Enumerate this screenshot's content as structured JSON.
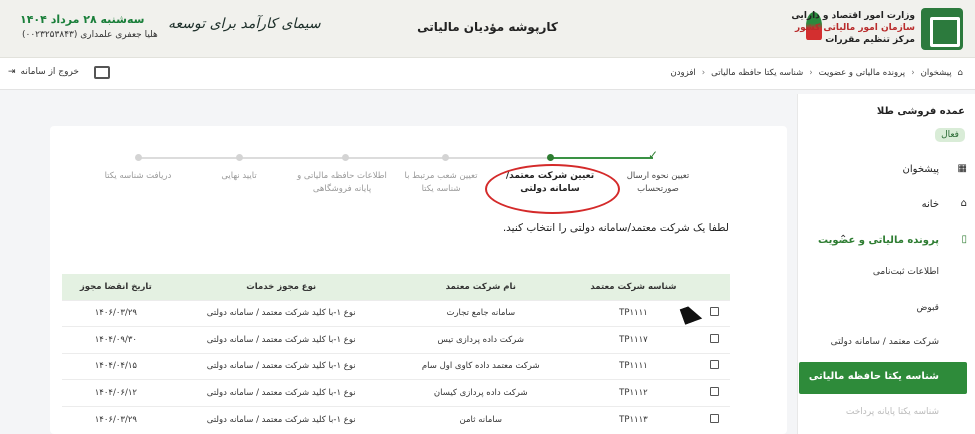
{
  "header": {
    "title": "کارپوشه مؤدیان مالیاتی",
    "date": "سه‌شنبه ۲۸ مرداد ۱۴۰۴",
    "user": "هلیا جعفری علمداری (۰۰۲۳۲۵۳۸۴۳)",
    "motto": "سیمای کارآمد برای توسعه",
    "org_lines": [
      "وزارت امور اقتصاد و دارایی",
      "سازمان امور مالیاتی کشور",
      "مرکز تنظیم مقررات"
    ]
  },
  "toolbar": {
    "exit_label": "خروج از سامانه",
    "breadcrumbs": [
      "پیشخوان",
      "پرونده مالیاتی و عضویت",
      "شناسه یکتا حافظه مالیاتی",
      "افزودن"
    ]
  },
  "sidebar": {
    "company": "عمده فروشی طلا",
    "status": "فعال",
    "items": [
      {
        "label": "پیشخوان",
        "icon": "dashboard-icon"
      },
      {
        "label": "خانه",
        "icon": "home-icon"
      },
      {
        "label": "پرونده مالیاتی و عضویت",
        "icon": "file-icon"
      }
    ],
    "sub_items": [
      "اطلاعات ثبت‌نامی",
      "قبوض",
      "شرکت معتمد / سامانه دولتی",
      "شناسه یکتا حافظه مالیاتی",
      "شناسه یکتا پایانه پرداخت"
    ]
  },
  "stepper": {
    "steps": [
      "تعیین نحوه ارسال صورتحساب",
      "تعیین شرکت معتمد/سامانه دولتی",
      "تعیین شعب مرتبط با شناسه یکتا",
      "اطلاعات حافظه مالیاتی و پایانه فروشگاهی",
      "تایید نهایی",
      "دریافت شناسه یکتا"
    ],
    "current_step": 2
  },
  "prompt": "لطفا یک شرکت معتمد/سامانه دولتی را انتخاب کنید.",
  "table": {
    "headers": [
      "شناسه شرکت معتمد",
      "نام شرکت معتمد",
      "نوع مجوز خدمات",
      "تاریخ انقضا مجوز"
    ],
    "rows": [
      [
        "TP۱۱۱۱",
        "سامانه جامع تجارت",
        "نوع ۱-با کلید شرکت معتمد / سامانه دولتی",
        "۱۴۰۶/۰۳/۲۹"
      ],
      [
        "TP۱۱۱۷",
        "شرکت داده پردازی تیس",
        "نوع ۱-با کلید شرکت معتمد / سامانه دولتی",
        "۱۴۰۴/۰۹/۳۰"
      ],
      [
        "TP۱۱۱۱",
        "شرکت معتمد داده کاوی اول سام",
        "نوع ۱-با کلید شرکت معتمد / سامانه دولتی",
        "۱۴۰۴/۰۴/۱۵"
      ],
      [
        "TP۱۱۱۲",
        "شرکت داده پردازی کیسان",
        "نوع ۱-با کلید شرکت معتمد / سامانه دولتی",
        "۱۴۰۴/۰۶/۱۲"
      ],
      [
        "TP۱۱۱۳",
        "سامانه ثامن",
        "نوع ۱-با کلید شرکت معتمد / سامانه دولتی",
        "۱۴۰۶/۰۳/۲۹"
      ]
    ]
  },
  "colors": {
    "accent": "#2e8b3a",
    "header_bg": "#f1f1ed",
    "annotation": "#d42a2a"
  }
}
